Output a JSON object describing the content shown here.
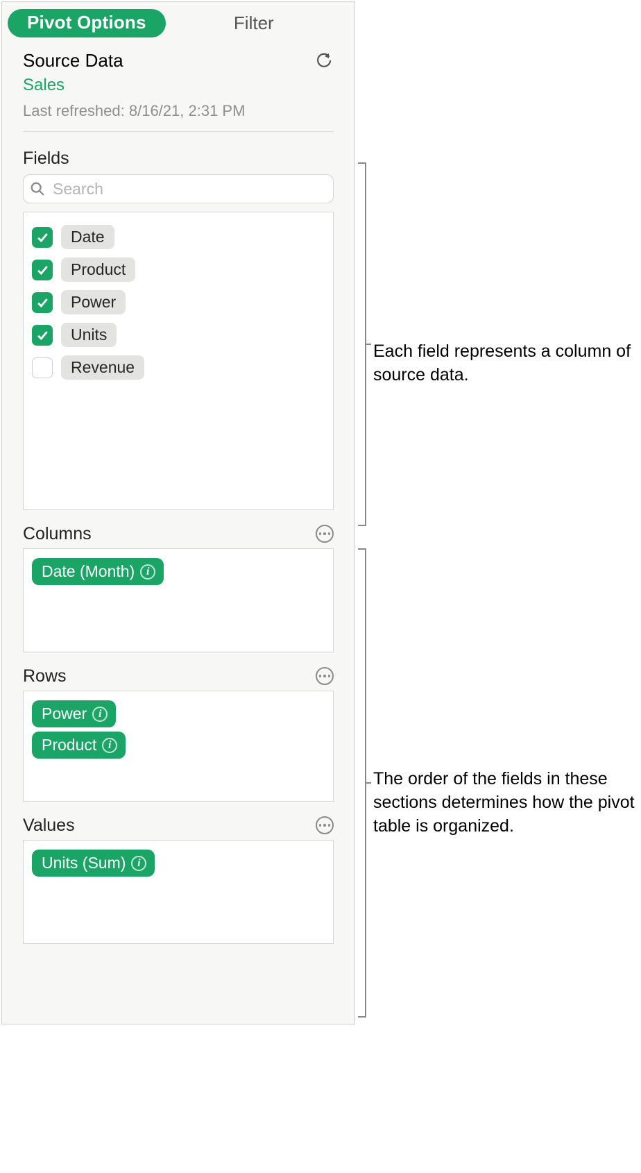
{
  "tabs": {
    "active": "Pivot Options",
    "inactive": "Filter"
  },
  "source": {
    "heading": "Source Data",
    "name": "Sales",
    "last_refreshed": "Last refreshed: 8/16/21, 2:31 PM"
  },
  "fields_label": "Fields",
  "search": {
    "placeholder": "Search"
  },
  "fields": [
    {
      "label": "Date",
      "checked": true
    },
    {
      "label": "Product",
      "checked": true
    },
    {
      "label": "Power",
      "checked": true
    },
    {
      "label": "Units",
      "checked": true
    },
    {
      "label": "Revenue",
      "checked": false
    }
  ],
  "sections": {
    "columns": {
      "title": "Columns",
      "items": [
        "Date (Month)"
      ]
    },
    "rows": {
      "title": "Rows",
      "items": [
        "Power",
        "Product"
      ]
    },
    "values": {
      "title": "Values",
      "items": [
        "Units (Sum)"
      ]
    }
  },
  "callouts": {
    "fields": "Each field represents a column of source data.",
    "order": "The order of the fields in these sections determines how the pivot table is organized."
  }
}
